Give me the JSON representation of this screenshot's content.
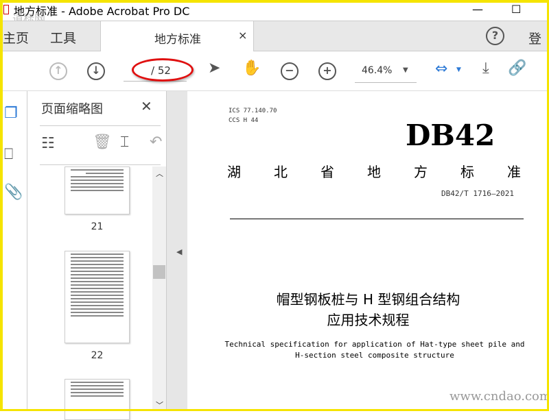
{
  "window": {
    "title": "地方标准 - Adobe Acrobat Pro DC",
    "watermark_top": "道标网",
    "minimize": "—",
    "maximize": "☐"
  },
  "tabs": {
    "home": "主页",
    "tools": "工具",
    "doc_tab": "地方标准",
    "close": "×",
    "help": "?",
    "login": "登录"
  },
  "toolbar": {
    "page_total": "/ 52",
    "zoom": "46.4%"
  },
  "panel": {
    "title": "页面缩略图",
    "close": "✕",
    "thumbs": [
      {
        "label": "21"
      },
      {
        "label": "22"
      }
    ]
  },
  "document": {
    "ics": "ICS  77.140.70",
    "ccs": "CCS H 44",
    "code": "DB42",
    "province_std": "湖北省地方标准",
    "std_no": "DB42/T 1716—2021",
    "title_cn_1": "帽型钢板桩与 H 型钢组合结构",
    "title_cn_2": "应用技术规程",
    "title_en_1": "Technical specification for application of Hat-type sheet pile and",
    "title_en_2": "H-section steel composite structure"
  },
  "watermark": "www.cndao.com",
  "colors": {
    "accent": "#2d7ad6",
    "annotation": "#e01010",
    "frame": "#f5e400"
  }
}
